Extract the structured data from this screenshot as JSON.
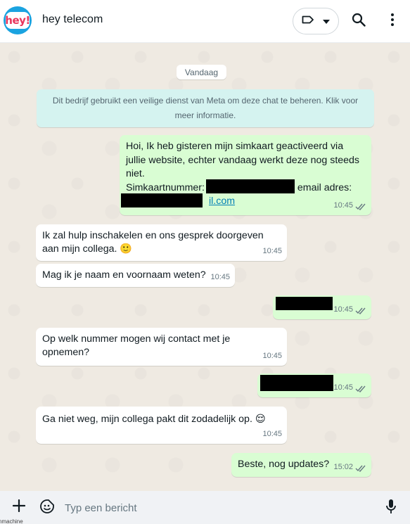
{
  "header": {
    "avatar_text": "hey!",
    "contact_name": "hey telecom"
  },
  "chat": {
    "date_label": "Vandaag",
    "system_message": "Dit bedrijf gebruikt een veilige dienst van Meta om deze chat te beheren. Klik voor meer informatie.",
    "messages": [
      {
        "direction": "out",
        "lines": [
          "Hoi, Ik heb gisteren mijn simkaart geactiveerd via",
          "jullie website, echter vandaag werkt deze nog steeds",
          "niet."
        ],
        "sim_label": "Simkaartnummer:",
        "email_label": "/ email adres:",
        "link_fragment": "il.com",
        "time": "10:45"
      },
      {
        "direction": "in",
        "text": "Ik zal hulp inschakelen en ons gesprek doorgeven\naan mijn collega. 🙂",
        "time": "10:45"
      },
      {
        "direction": "in",
        "text": "Mag ik je naam en voornaam weten?",
        "time": "10:45"
      },
      {
        "direction": "out",
        "text": "",
        "time": "10:45"
      },
      {
        "direction": "in",
        "text": "Op welk nummer mogen wij contact met je\nopnemen?",
        "time": "10:45"
      },
      {
        "direction": "out",
        "text": "",
        "time": "10:45"
      },
      {
        "direction": "in",
        "text": "Ga niet weg, mijn collega pakt dit zodadelijk op. 😌",
        "time": "10:45"
      },
      {
        "direction": "out",
        "text": "Beste, nog updates?",
        "time": "15:02"
      }
    ]
  },
  "composer": {
    "placeholder": "Typ een bericht"
  },
  "footer_fragment": "nmachine",
  "colors": {
    "outgoing_bubble": "#d9fdd3",
    "incoming_bubble": "#ffffff",
    "chat_background": "#efeae2",
    "tick_blue_grey": "#667781"
  }
}
